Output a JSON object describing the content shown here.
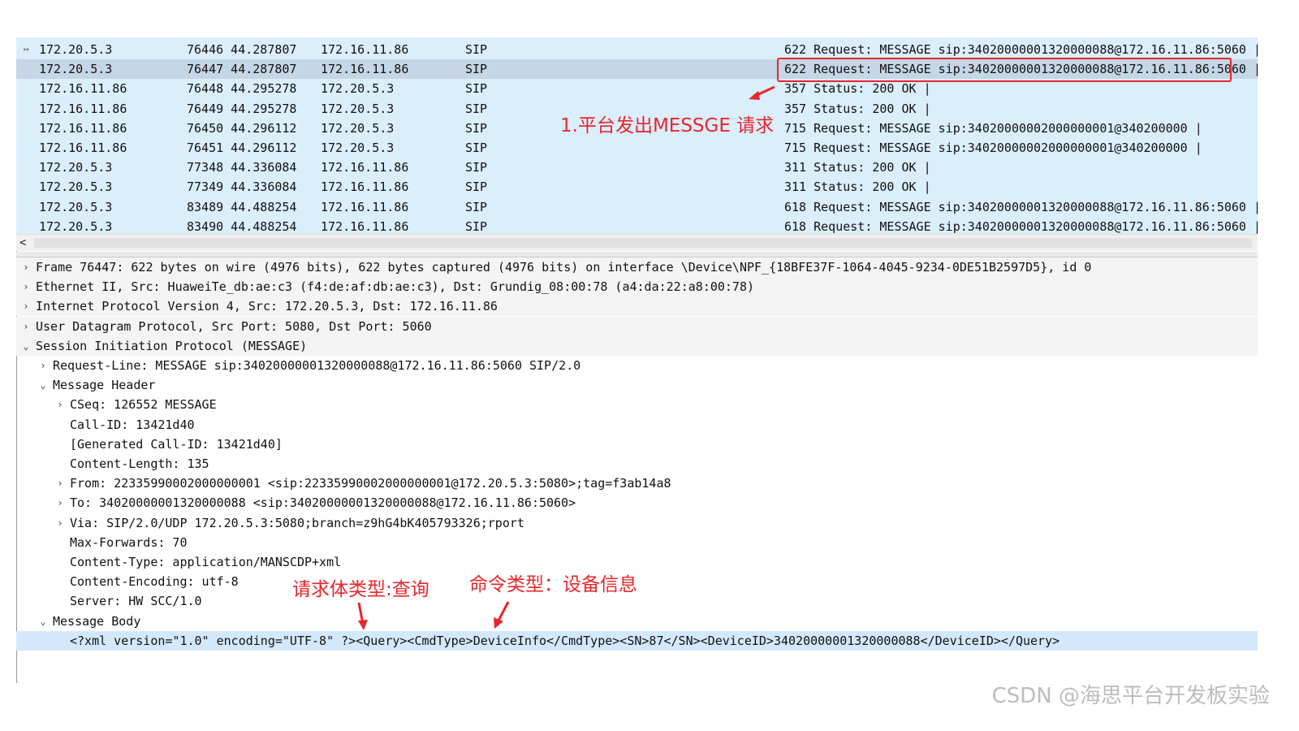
{
  "packet_list": {
    "rows": [
      {
        "src": "172.20.5.3",
        "no_time": "76446 44.287807",
        "dst": "172.16.11.86",
        "proto": "SIP",
        "info": "622 Request: MESSAGE sip:34020000001320000088@172.16.11.86:5060 |",
        "selected": false,
        "related": true
      },
      {
        "src": "172.20.5.3",
        "no_time": "76447 44.287807",
        "dst": "172.16.11.86",
        "proto": "SIP",
        "info": "622 Request: MESSAGE sip:34020000001320000088@172.16.11.86:5060 |",
        "selected": true,
        "related": false
      },
      {
        "src": "172.16.11.86",
        "no_time": "76448 44.295278",
        "dst": "172.20.5.3",
        "proto": "SIP",
        "info": "357 Status: 200 OK |",
        "selected": false,
        "related": false
      },
      {
        "src": "172.16.11.86",
        "no_time": "76449 44.295278",
        "dst": "172.20.5.3",
        "proto": "SIP",
        "info": "357 Status: 200 OK |",
        "selected": false,
        "related": false
      },
      {
        "src": "172.16.11.86",
        "no_time": "76450 44.296112",
        "dst": "172.20.5.3",
        "proto": "SIP",
        "info": "715 Request: MESSAGE sip:34020000002000000001@340200000 |",
        "selected": false,
        "related": false
      },
      {
        "src": "172.16.11.86",
        "no_time": "76451 44.296112",
        "dst": "172.20.5.3",
        "proto": "SIP",
        "info": "715 Request: MESSAGE sip:34020000002000000001@340200000 |",
        "selected": false,
        "related": false
      },
      {
        "src": "172.20.5.3",
        "no_time": "77348 44.336084",
        "dst": "172.16.11.86",
        "proto": "SIP",
        "info": "311 Status: 200 OK |",
        "selected": false,
        "related": false
      },
      {
        "src": "172.20.5.3",
        "no_time": "77349 44.336084",
        "dst": "172.16.11.86",
        "proto": "SIP",
        "info": "311 Status: 200 OK |",
        "selected": false,
        "related": false
      },
      {
        "src": "172.20.5.3",
        "no_time": "83489 44.488254",
        "dst": "172.16.11.86",
        "proto": "SIP",
        "info": "618 Request: MESSAGE sip:34020000001320000088@172.16.11.86:5060 |",
        "selected": false,
        "related": false
      },
      {
        "src": "172.20.5.3",
        "no_time": "83490 44.488254",
        "dst": "172.16.11.86",
        "proto": "SIP",
        "info": "618 Request: MESSAGE sip:34020000001320000088@172.16.11.86:5060 |",
        "selected": false,
        "related": false
      }
    ]
  },
  "scrollbar": {
    "left_arrow": "<"
  },
  "details": {
    "rows": [
      {
        "level": 0,
        "toggle": "collapsed",
        "text": "Frame 76447: 622 bytes on wire (4976 bits), 622 bytes captured (4976 bits) on interface \\Device\\NPF_{18BFE37F-1064-4045-9234-0DE51B2597D5}, id 0",
        "style": "gray"
      },
      {
        "level": 0,
        "toggle": "collapsed",
        "text": "Ethernet II, Src: HuaweiTe_db:ae:c3 (f4:de:af:db:ae:c3), Dst: Grundig_08:00:78 (a4:da:22:a8:00:78)",
        "style": "gray"
      },
      {
        "level": 0,
        "toggle": "collapsed",
        "text": "Internet Protocol Version 4, Src: 172.20.5.3, Dst: 172.16.11.86",
        "style": "gray"
      },
      {
        "level": 0,
        "toggle": "collapsed",
        "text": "User Datagram Protocol, Src Port: 5080, Dst Port: 5060",
        "style": "gray"
      },
      {
        "level": 0,
        "toggle": "expanded",
        "text": "Session Initiation Protocol (MESSAGE)",
        "style": "gray"
      },
      {
        "level": 1,
        "toggle": "collapsed",
        "text": "Request-Line: MESSAGE sip:34020000001320000088@172.16.11.86:5060 SIP/2.0",
        "style": ""
      },
      {
        "level": 1,
        "toggle": "expanded",
        "text": "Message Header",
        "style": ""
      },
      {
        "level": 2,
        "toggle": "collapsed",
        "text": "CSeq: 126552 MESSAGE",
        "style": ""
      },
      {
        "level": 2,
        "toggle": "none",
        "text": "Call-ID: 13421d40",
        "style": ""
      },
      {
        "level": 2,
        "toggle": "none",
        "text": "[Generated Call-ID: 13421d40]",
        "style": ""
      },
      {
        "level": 2,
        "toggle": "none",
        "text": "Content-Length: 135",
        "style": ""
      },
      {
        "level": 2,
        "toggle": "collapsed",
        "text": "From: 22335990002000000001 <sip:22335990002000000001@172.20.5.3:5080>;tag=f3ab14a8",
        "style": ""
      },
      {
        "level": 2,
        "toggle": "collapsed",
        "text": "To: 34020000001320000088 <sip:34020000001320000088@172.16.11.86:5060>",
        "style": ""
      },
      {
        "level": 2,
        "toggle": "collapsed",
        "text": "Via: SIP/2.0/UDP 172.20.5.3:5080;branch=z9hG4bK405793326;rport",
        "style": ""
      },
      {
        "level": 2,
        "toggle": "none",
        "text": "Max-Forwards: 70",
        "style": ""
      },
      {
        "level": 2,
        "toggle": "none",
        "text": "Content-Type: application/MANSCDP+xml",
        "style": ""
      },
      {
        "level": 2,
        "toggle": "none",
        "text": "Content-Encoding: utf-8",
        "style": ""
      },
      {
        "level": 2,
        "toggle": "none",
        "text": "Server: HW SCC/1.0",
        "style": ""
      },
      {
        "level": 1,
        "toggle": "expanded",
        "text": "Message Body",
        "style": ""
      },
      {
        "level": 2,
        "toggle": "none",
        "text": "<?xml version=\"1.0\" encoding=\"UTF-8\" ?><Query><CmdType>DeviceInfo</CmdType><SN>87</SN><DeviceID>34020000001320000088</DeviceID></Query>",
        "style": "hl"
      }
    ]
  },
  "annotations": {
    "platform_request": "1.平台发出MESSGE 请求",
    "body_type": "请求体类型:查询",
    "cmd_type": "命令类型：设备信息",
    "color": "#e8262b"
  },
  "watermark": "CSDN @海思平台开发板实验"
}
